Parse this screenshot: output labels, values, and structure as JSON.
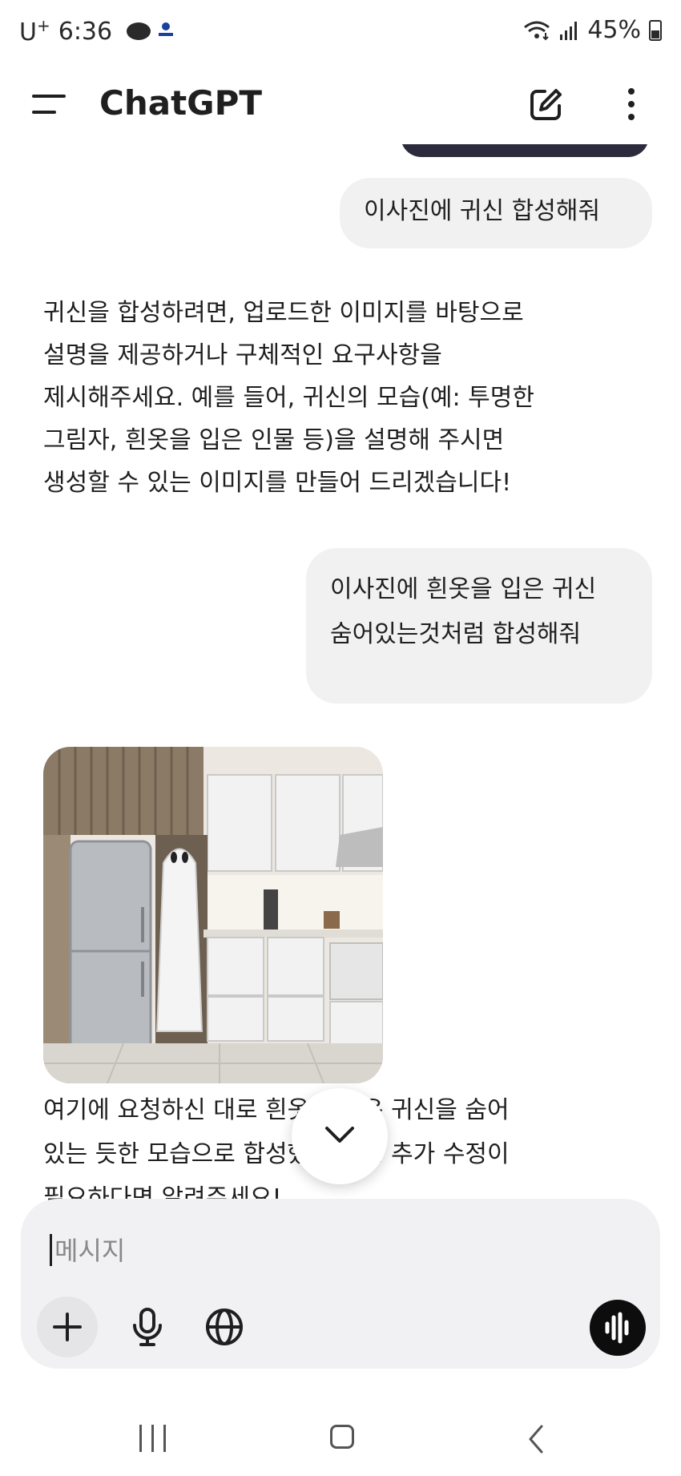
{
  "status_bar": {
    "carrier": "U",
    "carrier_sup": "+",
    "time": "6:36",
    "battery": "45%",
    "icons": [
      "chat-bubble-icon",
      "won-app-icon",
      "wifi-icon",
      "signal-icon",
      "battery-icon"
    ]
  },
  "header": {
    "title": "ChatGPT",
    "icons": [
      "menu-icon",
      "new-chat-icon",
      "more-vertical-icon"
    ]
  },
  "messages": [
    {
      "role": "user",
      "lines": [
        "이사진에 귀신 합성해줘"
      ]
    },
    {
      "role": "assistant",
      "lines": [
        "귀신을 합성하려면, 업로드한 이미지를 바탕으로",
        "설명을 제공하거나 구체적인 요구사항을",
        "제시해주세요. 예를 들어, 귀신의 모습(예: 투명한",
        "그림자, 흰옷을 입은 인물 등)을 설명해 주시면",
        "생성할 수 있는 이미지를 만들어 드리겠습니다!"
      ]
    },
    {
      "role": "user",
      "lines": [
        "이사진에 흰옷을 입은 귀신",
        "숨어있는것처럼 합성해줘"
      ]
    },
    {
      "role": "assistant",
      "image": "kitchen-with-ghost-image",
      "lines": [
        "여기에 요청하신 대로 흰옷을 입은 귀신을 숨어",
        "있는 듯한 모습으로 합성했습니다. 추가 수정이",
        "필요하다면 알려주세요!"
      ]
    }
  ],
  "composer": {
    "placeholder": "메시지",
    "value": ""
  },
  "colors": {
    "bubble": "#f1f1f2",
    "composer": "#f1f0f2",
    "voice_button": "#0d0d0d"
  }
}
